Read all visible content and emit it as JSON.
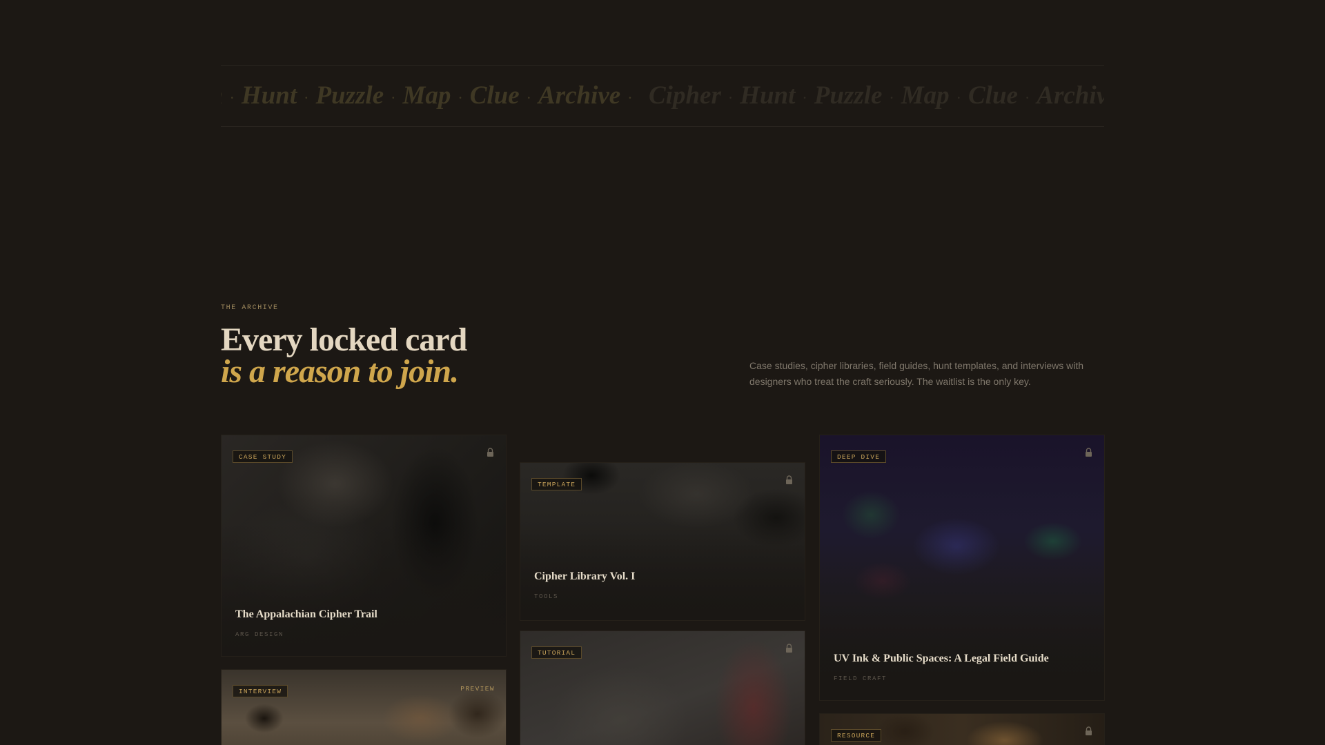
{
  "ticker": {
    "left_items": [
      "n",
      "Hunt",
      "Puzzle",
      "Map",
      "Clue",
      "Archive"
    ],
    "right_items": [
      "Cipher",
      "Hunt",
      "Puzzle",
      "Map",
      "Clue",
      "Archive"
    ],
    "separator": "·"
  },
  "intro": {
    "eyebrow": "THE ARCHIVE",
    "headline_line1": "Every locked card",
    "headline_line2": "is a reason to join.",
    "description": "Case studies, cipher libraries, field guides, hunt templates, and interviews with designers who treat the craft seriously. The waitlist is the only key."
  },
  "cards": [
    {
      "tag": "CASE STUDY",
      "title": "The Appalachian Cipher Trail",
      "meta": "ARG DESIGN",
      "icon": "lock-icon"
    },
    {
      "tag": "TEMPLATE",
      "title": "Cipher Library Vol. I",
      "meta": "TOOLS",
      "icon": "lock-icon"
    },
    {
      "tag": "DEEP DIVE",
      "title": "UV Ink & Public Spaces: A Legal Field Guide",
      "meta": "FIELD CRAFT",
      "icon": "lock-icon"
    },
    {
      "tag": "INTERVIEW",
      "preview": "PREVIEW"
    },
    {
      "tag": "TUTORIAL",
      "icon": "lock-icon"
    },
    {
      "tag": "RESOURCE",
      "icon": "lock-icon"
    }
  ],
  "colors": {
    "background": "#1c1814",
    "accent_gold": "#cfa64c",
    "headline_cream": "#e4d7c1",
    "muted_text": "#7f776b"
  }
}
